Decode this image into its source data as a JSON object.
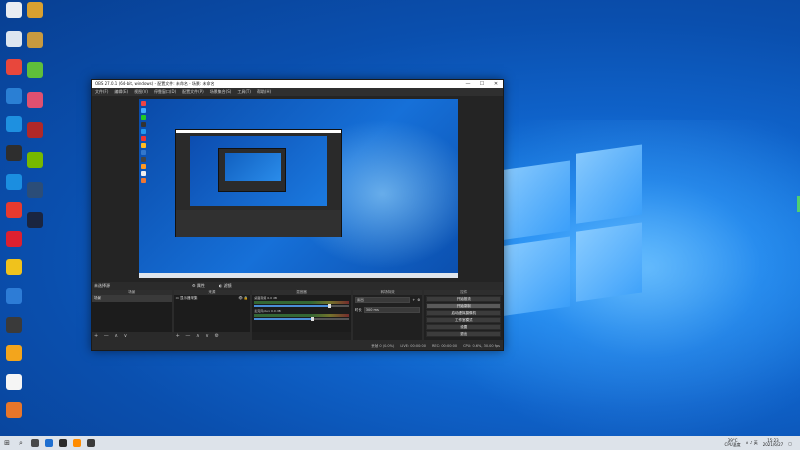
{
  "desktop": {
    "icons_left": [
      {
        "label": "",
        "color": "#e9edf2"
      },
      {
        "label": "",
        "color": "#dde6f0"
      },
      {
        "label": "",
        "color": "#e8473c"
      },
      {
        "label": "",
        "color": "#2a7fd4"
      },
      {
        "label": "",
        "color": "#1e90e0"
      },
      {
        "label": "",
        "color": "#2e2e2e"
      },
      {
        "label": "",
        "color": "#1b8ee0"
      },
      {
        "label": "",
        "color": "#e93a2e"
      },
      {
        "label": "",
        "color": "#dd2030"
      },
      {
        "label": "",
        "color": "#f0c21c"
      },
      {
        "label": "",
        "color": "#2d7cd6"
      },
      {
        "label": "",
        "color": "#3a3a3a"
      },
      {
        "label": "",
        "color": "#f3a51c"
      },
      {
        "label": "",
        "color": "#f5f5f5"
      },
      {
        "label": "",
        "color": "#e8762a"
      }
    ],
    "icons_right": [
      {
        "label": "",
        "color": "#d8a030"
      },
      {
        "label": "",
        "color": "#c89a40"
      },
      {
        "label": "",
        "color": "#5fbf3a"
      },
      {
        "label": "",
        "color": "#e05070"
      },
      {
        "label": "",
        "color": "#b02828"
      },
      {
        "label": "",
        "color": "#76b900"
      },
      {
        "label": "",
        "color": "#2b4d78"
      },
      {
        "label": "",
        "color": "#1a2540"
      }
    ]
  },
  "obs": {
    "title": "OBS 27.0.1 (64-bit, windows) - 配置文件: 未命名 - 场景: 未命名",
    "window_controls": [
      "—",
      "☐",
      "✕"
    ],
    "menu": [
      "文件(F)",
      "编辑(E)",
      "视图(V)",
      "停靠窗口(D)",
      "配置文件(P)",
      "场景集合(S)",
      "工具(T)",
      "帮助(H)"
    ],
    "source_bar": {
      "label": "未选择源",
      "properties": "属性",
      "filters": "滤镜"
    },
    "docks": {
      "scenes": {
        "title": "场景",
        "items": [
          "场景"
        ]
      },
      "sources": {
        "title": "来源",
        "items": [
          "显示器采集"
        ]
      },
      "mixer": {
        "title": "混音器",
        "channels": [
          {
            "name": "桌面音频",
            "level": "0.0 dB"
          },
          {
            "name": "麦克风/Aux",
            "level": "0.0 dB"
          }
        ]
      },
      "transitions": {
        "title": "转场特效",
        "type": "淡出",
        "duration_label": "时长",
        "duration_value": "300 ms"
      },
      "controls": {
        "title": "控件",
        "buttons": [
          "开始推流",
          "开始录制",
          "启动虚拟摄像机",
          "工作室模式",
          "设置",
          "退出"
        ]
      }
    },
    "dock_footer": "+ — ∧ ∨",
    "status": {
      "drop": "丢帧 0 (0.0%)",
      "live": "LIVE: 00:00:00",
      "rec": "REC: 00:00:00",
      "cpu": "CPU: 0.6%, 30.00 fps"
    }
  },
  "taskbar": {
    "start_glyph": "⊞",
    "search_glyph": "⌕",
    "apps": [
      "#4a4a4a",
      "#1f6fd0",
      "#2a2a2a",
      "#ff8c00",
      "#3a3a3a"
    ],
    "cpu_value": "39°C",
    "cpu_label": "CPU温度",
    "tray_glyphs": "∧ ♪ 英",
    "time": "15:23",
    "date": "2021/6/27"
  }
}
